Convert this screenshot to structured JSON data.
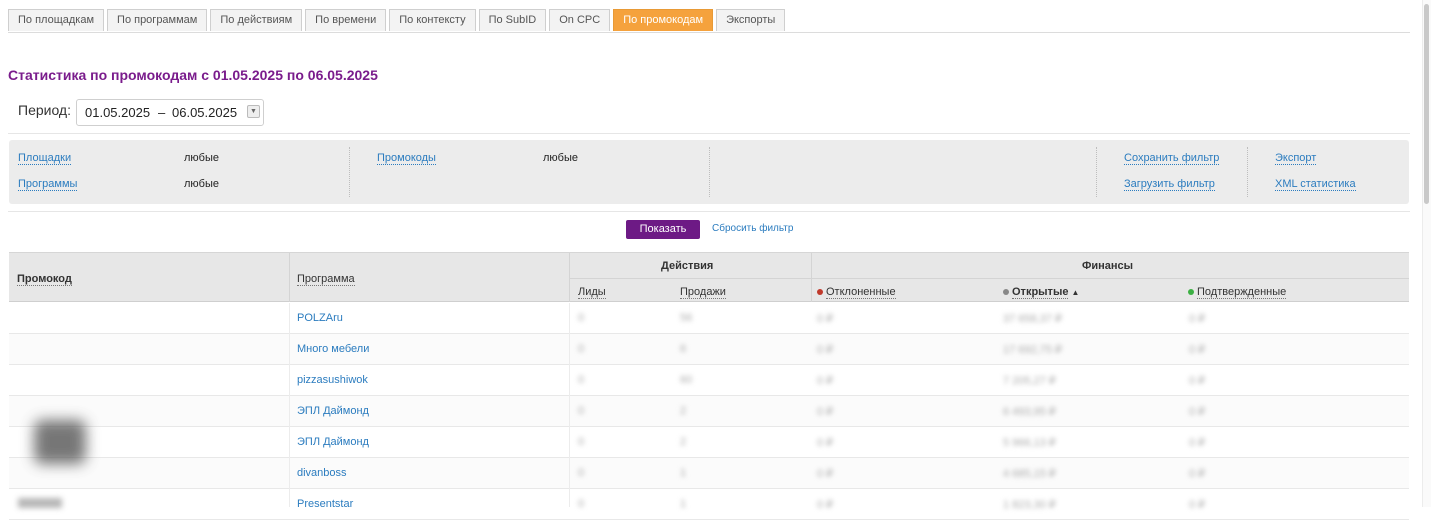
{
  "tabs": [
    {
      "label": "По площадкам",
      "active": false
    },
    {
      "label": "По программам",
      "active": false
    },
    {
      "label": "По действиям",
      "active": false
    },
    {
      "label": "По времени",
      "active": false
    },
    {
      "label": "По контексту",
      "active": false
    },
    {
      "label": "По SubID",
      "active": false
    },
    {
      "label": "On CPC",
      "active": false
    },
    {
      "label": "По промокодам",
      "active": true
    },
    {
      "label": "Экспорты",
      "active": false
    }
  ],
  "accent_color": "#f5a23d",
  "brand_color": "#6d1a85",
  "page_title": "Статистика по промокодам с 01.05.2025 по 06.05.2025",
  "period": {
    "label": "Период:",
    "from": "01.05.2025",
    "dash": "–",
    "to": "06.05.2025"
  },
  "filters": {
    "platforms_label": "Площадки",
    "platforms_value": "любые",
    "programs_label": "Программы",
    "programs_value": "любые",
    "promocodes_label": "Промокоды",
    "promocodes_value": "любые",
    "save_filter": "Сохранить фильтр",
    "load_filter": "Загрузить фильтр",
    "export": "Экспорт",
    "xml_stats": "XML статистика"
  },
  "actions": {
    "show": "Показать",
    "reset": "Сбросить фильтр"
  },
  "table": {
    "headers": {
      "promocode": "Промокод",
      "program": "Программа",
      "actions_group": "Действия",
      "finance_group": "Финансы",
      "leads": "Лиды",
      "sales": "Продажи",
      "rejected": "Отклоненные",
      "open": "Открытые",
      "confirmed": "Подтвержденные"
    },
    "status_colors": {
      "rejected": "#c0392b",
      "open": "#888888",
      "confirmed": "#3cb043"
    },
    "rows": [
      {
        "program": "POLZAru",
        "leads": "0",
        "sales": "56",
        "rejected": "0 ₽",
        "open": "37 658,37 ₽",
        "confirmed": "0 ₽"
      },
      {
        "program": "Много мебели",
        "leads": "0",
        "sales": "6",
        "rejected": "0 ₽",
        "open": "17 692,75 ₽",
        "confirmed": "0 ₽"
      },
      {
        "program": "pizzasushiwok",
        "leads": "0",
        "sales": "60",
        "rejected": "0 ₽",
        "open": "7 205,27 ₽",
        "confirmed": "0 ₽"
      },
      {
        "program": "ЭПЛ Даймонд",
        "leads": "0",
        "sales": "2",
        "rejected": "0 ₽",
        "open": "6 493,95 ₽",
        "confirmed": "0 ₽"
      },
      {
        "program": "ЭПЛ Даймонд",
        "leads": "0",
        "sales": "2",
        "rejected": "0 ₽",
        "open": "5 966,13 ₽",
        "confirmed": "0 ₽"
      },
      {
        "program": "divanboss",
        "leads": "0",
        "sales": "1",
        "rejected": "0 ₽",
        "open": "4 685,15 ₽",
        "confirmed": "0 ₽"
      },
      {
        "program": "Presentstar",
        "leads": "0",
        "sales": "1",
        "rejected": "0 ₽",
        "open": "1 823,30 ₽",
        "confirmed": "0 ₽"
      }
    ]
  }
}
